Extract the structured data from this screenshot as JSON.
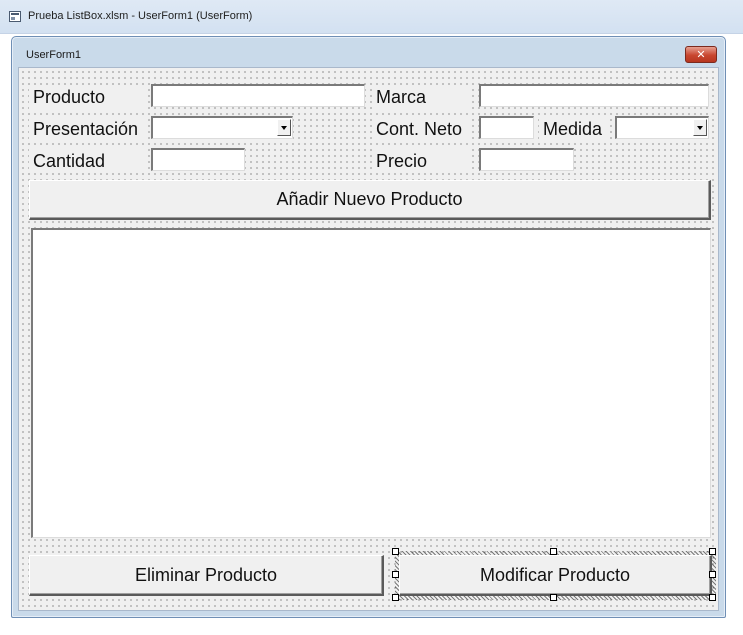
{
  "designer": {
    "title": "Prueba ListBox.xlsm - UserForm1 (UserForm)"
  },
  "userform": {
    "title": "UserForm1",
    "close_glyph": "✕",
    "labels": {
      "producto": "Producto",
      "marca": "Marca",
      "presentacion": "Presentación",
      "cont_neto": "Cont. Neto",
      "medida": "Medida",
      "cantidad": "Cantidad",
      "precio": "Precio"
    },
    "inputs": {
      "producto": "",
      "marca": "",
      "presentacion": "",
      "cont_neto": "",
      "medida": "",
      "cantidad": "",
      "precio": ""
    },
    "buttons": {
      "add": "Añadir Nuevo Producto",
      "delete": "Eliminar Producto",
      "modify": "Modificar Producto"
    },
    "listbox_items": []
  },
  "icons": {
    "window": "userform-window-icon",
    "close": "close-icon",
    "dropdown": "chevron-down-icon"
  },
  "colors": {
    "form_background": "#f0f0f0",
    "frame": "#c9daea",
    "close_button": "#c8462f"
  }
}
